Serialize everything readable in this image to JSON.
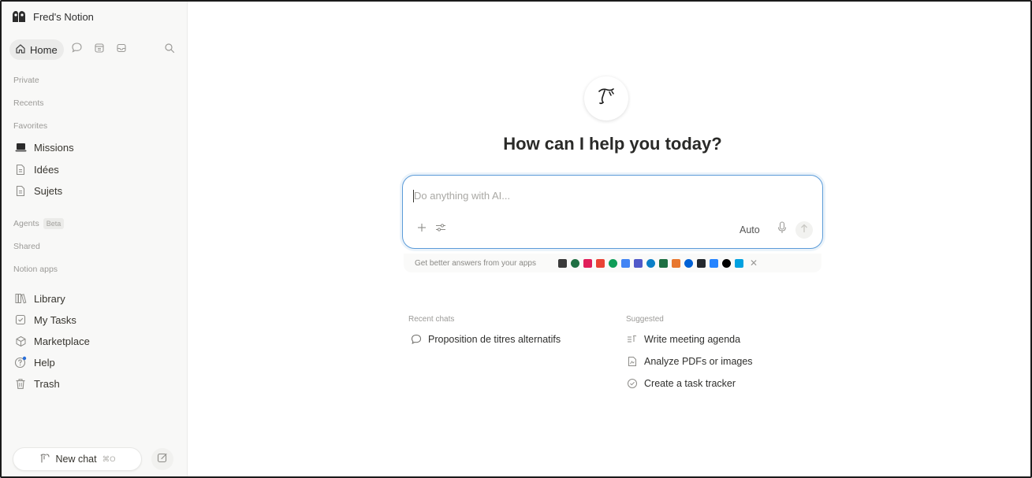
{
  "workspace": {
    "name": "Fred's Notion"
  },
  "topnav": {
    "home_label": "Home"
  },
  "sidebar": {
    "sections": {
      "private": "Private",
      "recents": "Recents",
      "favorites": "Favorites",
      "agents": "Agents",
      "agents_badge": "Beta",
      "shared": "Shared",
      "notion_apps": "Notion apps"
    },
    "favorites": [
      {
        "label": "Missions",
        "icon": "laptop-icon"
      },
      {
        "label": "Idées",
        "icon": "page-icon"
      },
      {
        "label": "Sujets",
        "icon": "page-icon"
      }
    ],
    "apps": [
      {
        "label": "Library",
        "icon": "library-icon"
      },
      {
        "label": "My Tasks",
        "icon": "tasks-icon"
      },
      {
        "label": "Marketplace",
        "icon": "marketplace-icon"
      },
      {
        "label": "Help",
        "icon": "help-icon"
      },
      {
        "label": "Trash",
        "icon": "trash-icon"
      }
    ],
    "new_chat": {
      "label": "New chat",
      "shortcut": "⌘O"
    }
  },
  "main": {
    "headline": "How can I help you today?",
    "chat": {
      "placeholder": "Do anything with AI...",
      "mode": "Auto"
    },
    "apps_bar": {
      "label": "Get better answers from your apps",
      "colors": [
        "#3a3a3a",
        "#1f6f43",
        "#e01e5a",
        "#ea4335",
        "#0f9d58",
        "#4285f4",
        "#5059c9",
        "#0b7fc7",
        "#1d6f42",
        "#e8772e",
        "#0061d5",
        "#24292f",
        "#2684ff",
        "#000000",
        "#00a1e0"
      ]
    },
    "recent": {
      "title": "Recent chats",
      "items": [
        {
          "label": "Proposition de titres alternatifs"
        }
      ]
    },
    "suggested": {
      "title": "Suggested",
      "items": [
        {
          "label": "Write meeting agenda",
          "icon": "agenda-icon"
        },
        {
          "label": "Analyze PDFs or images",
          "icon": "pdf-icon"
        },
        {
          "label": "Create a task tracker",
          "icon": "check-circle-icon"
        }
      ]
    }
  }
}
